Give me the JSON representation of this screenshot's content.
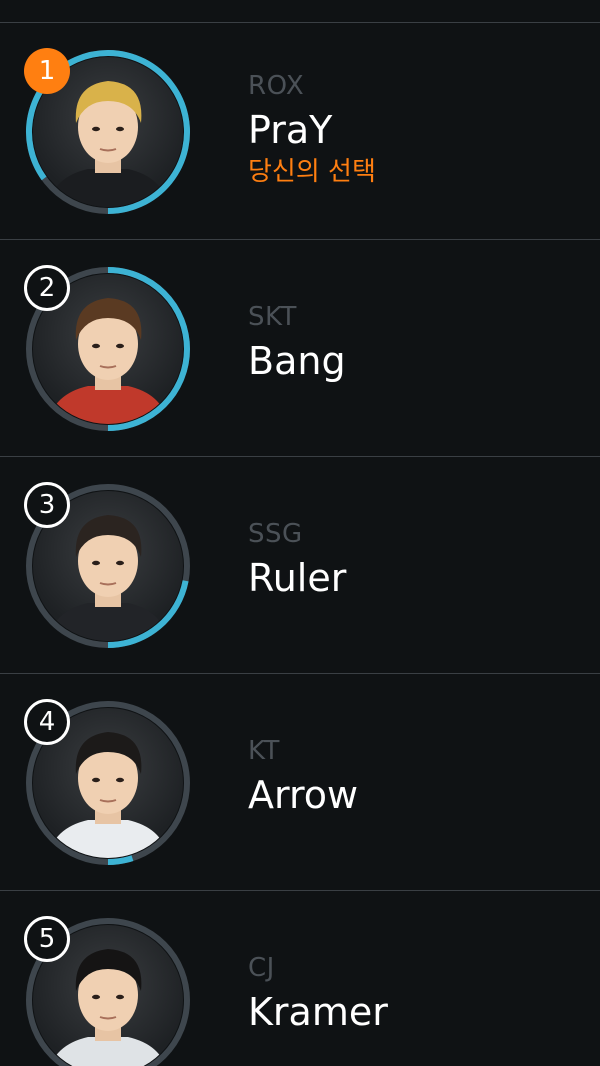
{
  "players": [
    {
      "rank": "1",
      "team": "ROX",
      "name": "PraY",
      "pick_label": "당신의 선택",
      "vote_share": 0.85,
      "hair": "#d9b24a",
      "jersey": "#1b1d20",
      "top": true
    },
    {
      "rank": "2",
      "team": "SKT",
      "name": "Bang",
      "pick_label": "",
      "vote_share": 0.5,
      "hair": "#5a3a22",
      "jersey": "#c0392b",
      "top": false
    },
    {
      "rank": "3",
      "team": "SSG",
      "name": "Ruler",
      "pick_label": "",
      "vote_share": 0.22,
      "hair": "#2b2420",
      "jersey": "#222428",
      "top": false
    },
    {
      "rank": "4",
      "team": "KT",
      "name": "Arrow",
      "pick_label": "",
      "vote_share": 0.05,
      "hair": "#1c1a19",
      "jersey": "#e9ecef",
      "top": false
    },
    {
      "rank": "5",
      "team": "CJ",
      "name": "Kramer",
      "pick_label": "",
      "vote_share": 0.02,
      "hair": "#151414",
      "jersey": "#dfe3e6",
      "top": false
    }
  ],
  "colors": {
    "accent": "#ff7f11",
    "progress": "#3db3d4",
    "track": "#3e464d",
    "background": "#0f1214",
    "team_text": "#4b5157"
  }
}
